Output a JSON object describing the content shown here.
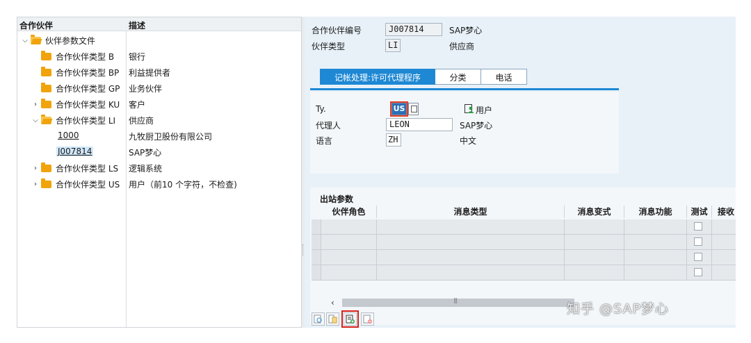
{
  "tree": {
    "header": {
      "col1": "合作伙伴",
      "col2": "描述"
    },
    "root": {
      "label": "伙伴参数文件"
    },
    "items": [
      {
        "label": "合作伙伴类型 B",
        "desc": "银行"
      },
      {
        "label": "合作伙伴类型 BP",
        "desc": "利益提供者"
      },
      {
        "label": "合作伙伴类型 GP",
        "desc": "业务伙伴"
      },
      {
        "label": "合作伙伴类型 KU",
        "desc": "客户"
      },
      {
        "label": "合作伙伴类型 LI",
        "desc": "供应商"
      },
      {
        "label": "合作伙伴类型 LS",
        "desc": "逻辑系统"
      },
      {
        "label": "合作伙伴类型 US",
        "desc": "用户（前10 个字符，不检查)"
      }
    ],
    "children": [
      {
        "label": "1000",
        "desc": "九牧厨卫股份有限公司"
      },
      {
        "label": "J007814",
        "desc": "SAP梦心"
      }
    ]
  },
  "detail": {
    "partner_no_label": "合作伙伴编号",
    "partner_no_value": "J007814",
    "partner_no_desc": "SAP梦心",
    "partner_type_label": "伙伴类型",
    "partner_type_value": "LI",
    "partner_type_desc": "供应商"
  },
  "tabs": [
    {
      "label": "记帐处理:许可代理程序"
    },
    {
      "label": "分类"
    },
    {
      "label": "电话"
    }
  ],
  "panel": {
    "ty_label": "Ty.",
    "ty_value": "US",
    "ty_desc": "用户",
    "agent_label": "代理人",
    "agent_value": "LEON",
    "agent_desc": "SAP梦心",
    "lang_label": "语言",
    "lang_value": "ZH",
    "lang_desc": "中文"
  },
  "outbound": {
    "title": "出站参数",
    "columns": [
      "伙伴角色",
      "消息类型",
      "消息变式",
      "消息功能",
      "测试",
      "接收"
    ]
  },
  "colors": {
    "accent": "#1e88d4",
    "panel_bg": "#e8f1f8",
    "folder": "#f0a30a",
    "highlight_red": "#d8201b"
  },
  "watermark": "知乎 @SAP梦心"
}
